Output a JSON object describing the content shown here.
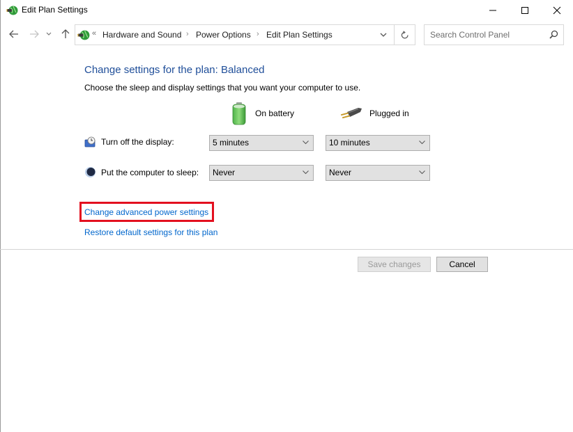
{
  "window": {
    "title": "Edit Plan Settings",
    "icons": {
      "app": "power-plug-globe-icon",
      "minimize": "minimize-icon",
      "maximize": "maximize-icon",
      "close": "close-icon"
    }
  },
  "navigation": {
    "overflow_chevron": "«",
    "breadcrumbs": [
      {
        "label": "Hardware and Sound"
      },
      {
        "label": "Power Options"
      },
      {
        "label": "Edit Plan Settings"
      }
    ],
    "separator": "›",
    "search": {
      "placeholder": "Search Control Panel",
      "value": ""
    }
  },
  "content": {
    "heading": "Change settings for the plan: Balanced",
    "description": "Choose the sleep and display settings that you want your computer to use.",
    "columns": [
      {
        "label": "On battery",
        "icon": "battery-icon"
      },
      {
        "label": "Plugged in",
        "icon": "power-plug-icon"
      }
    ],
    "settings": [
      {
        "label": "Turn off the display:",
        "icon": "display-clock-icon",
        "on_battery": "5 minutes",
        "plugged_in": "10 minutes"
      },
      {
        "label": "Put the computer to sleep:",
        "icon": "sleep-moon-icon",
        "on_battery": "Never",
        "plugged_in": "Never"
      }
    ],
    "links": {
      "advanced": "Change advanced power settings",
      "restore": "Restore default settings for this plan"
    },
    "highlight_color": "#e3101f"
  },
  "buttons": {
    "save": "Save changes",
    "save_enabled": false,
    "cancel": "Cancel"
  }
}
